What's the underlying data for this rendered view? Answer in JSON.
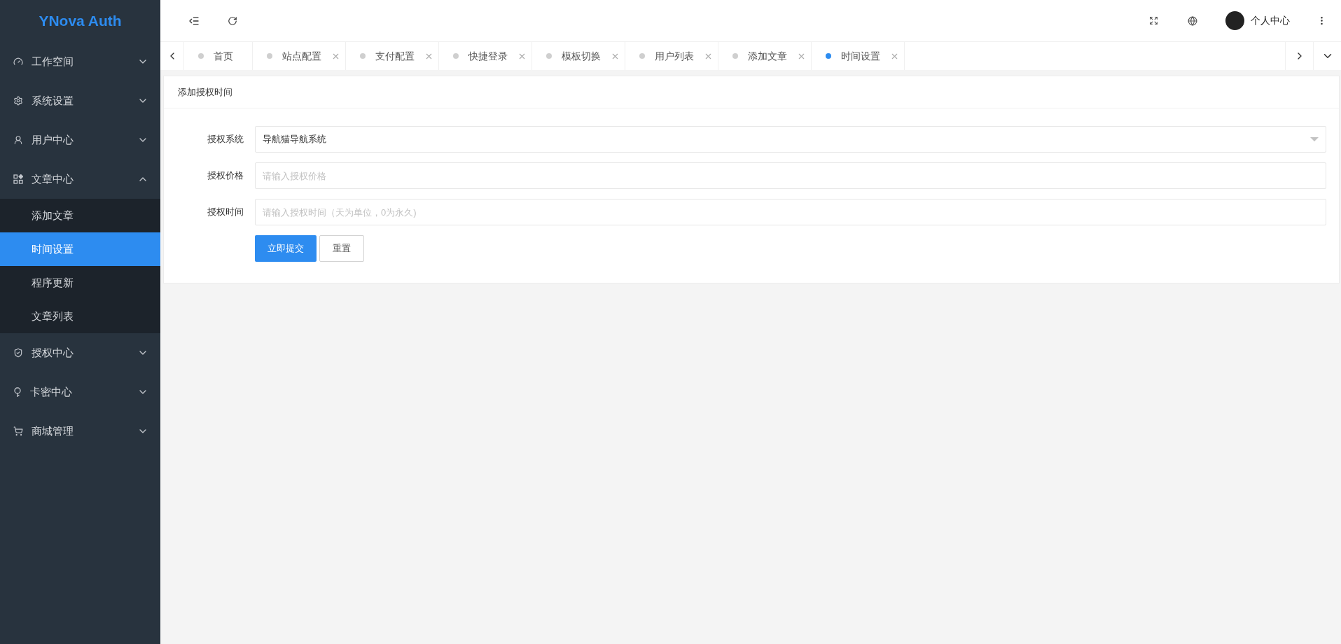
{
  "sidebar": {
    "logo": "YNova Auth",
    "items": [
      {
        "label": "工作空间",
        "expanded": false
      },
      {
        "label": "系统设置",
        "expanded": false
      },
      {
        "label": "用户中心",
        "expanded": false
      },
      {
        "label": "文章中心",
        "expanded": true,
        "children": [
          {
            "label": "添加文章",
            "selected": false
          },
          {
            "label": "时间设置",
            "selected": true
          },
          {
            "label": "程序更新",
            "selected": false
          },
          {
            "label": "文章列表",
            "selected": false
          }
        ]
      },
      {
        "label": "授权中心",
        "expanded": false
      },
      {
        "label": "卡密中心",
        "expanded": false
      },
      {
        "label": "商城管理",
        "expanded": false
      }
    ]
  },
  "header": {
    "profile": "个人中心"
  },
  "tabs": [
    {
      "label": "首页",
      "closable": false,
      "selected": false
    },
    {
      "label": "站点配置",
      "closable": true,
      "selected": false
    },
    {
      "label": "支付配置",
      "closable": true,
      "selected": false
    },
    {
      "label": "快捷登录",
      "closable": true,
      "selected": false
    },
    {
      "label": "模板切换",
      "closable": true,
      "selected": false
    },
    {
      "label": "用户列表",
      "closable": true,
      "selected": false
    },
    {
      "label": "添加文章",
      "closable": true,
      "selected": false
    },
    {
      "label": "时间设置",
      "closable": true,
      "selected": true
    }
  ],
  "card": {
    "title": "添加授权时间",
    "fields": [
      {
        "kind": "select",
        "label": "授权系统",
        "value": "导航猫导航系统"
      },
      {
        "kind": "input",
        "label": "授权价格",
        "placeholder": "请输入授权价格"
      },
      {
        "kind": "input",
        "label": "授权时间",
        "placeholder": "请输入授权时间（天为单位，0为永久)"
      }
    ],
    "buttons": [
      {
        "kind": "primary",
        "label": "立即提交"
      },
      {
        "kind": "default",
        "label": "重置"
      }
    ]
  }
}
